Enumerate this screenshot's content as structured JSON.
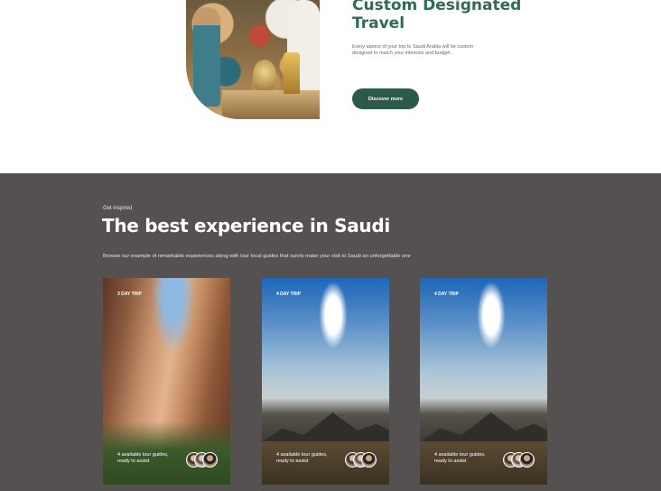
{
  "hero": {
    "title": "Custom Designated Travel",
    "description": "Every aspect of your trip to Saudi Arabia will be custom designed to match your interests and budget.",
    "button_label": "Discover more"
  },
  "inspire": {
    "eyebrow": "Get inspired",
    "title": "The best experience in Saudi",
    "description": "Browse our example of remarkable experiences along with tour local guides that surely make your visit to Saudi an unforgettable one",
    "cards": [
      {
        "badge": "3 DAY TRIP",
        "caption": "4 available tour guides, ready to assist"
      },
      {
        "badge": "4 DAY TRIP",
        "caption": "4 available tour guides, ready to assist"
      },
      {
        "badge": "4 DAY TRIP",
        "caption": "4 available tour guides, ready to assist"
      }
    ]
  },
  "colors": {
    "accent_green": "#2f6b55",
    "button_green": "#2b5a48",
    "dark_section": "#555150"
  }
}
